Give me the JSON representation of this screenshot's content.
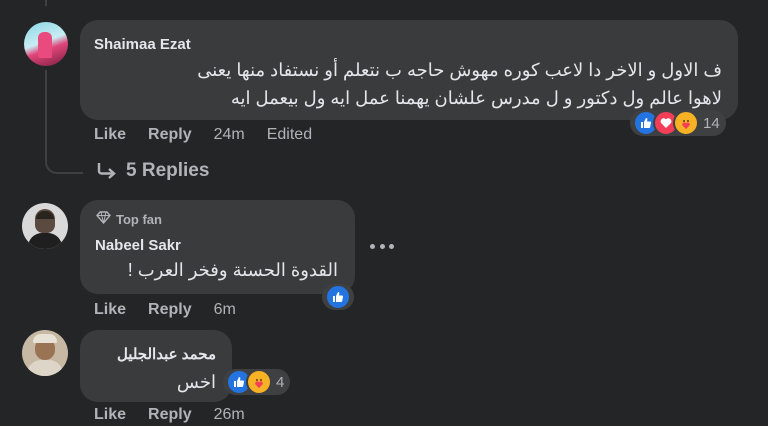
{
  "colors": {
    "background": "#242526",
    "bubble": "#3a3b3c",
    "text_primary": "#e4e6eb",
    "text_secondary": "#b0b3b8",
    "like_blue": "#2374e1",
    "love_red": "#f33e58",
    "care_yellow": "#f7b125"
  },
  "comments": [
    {
      "author": "Shaimaa Ezat",
      "text_lines": [
        "ف الاول و الاخر دا لاعب كوره مهوش حاجه ب نتعلم أو نستفاد منها يعنى",
        "لاهوا عالم ول دكتور و ل مدرس علشان يهمنا عمل ايه ول بيعمل ايه"
      ],
      "like_label": "Like",
      "reply_label": "Reply",
      "time": "24m",
      "edited_label": "Edited",
      "reactions": [
        "like-icon",
        "love-icon",
        "care-icon"
      ],
      "reaction_count": "14"
    },
    {
      "badge": "Top fan",
      "author": "Nabeel Sakr",
      "text": "القدوة الحسنة وفخر العرب !",
      "like_label": "Like",
      "reply_label": "Reply",
      "time": "6m",
      "reactions": [
        "like-icon"
      ]
    },
    {
      "author": "محمد عبدالجليل",
      "text": "اخس",
      "like_label": "Like",
      "reply_label": "Reply",
      "time": "26m",
      "reactions": [
        "like-icon",
        "care-icon"
      ],
      "reaction_count": "4"
    }
  ],
  "replies_link": {
    "label": "5 Replies",
    "icon": "reply-arrow-icon"
  },
  "more_options": "more-options-icon"
}
